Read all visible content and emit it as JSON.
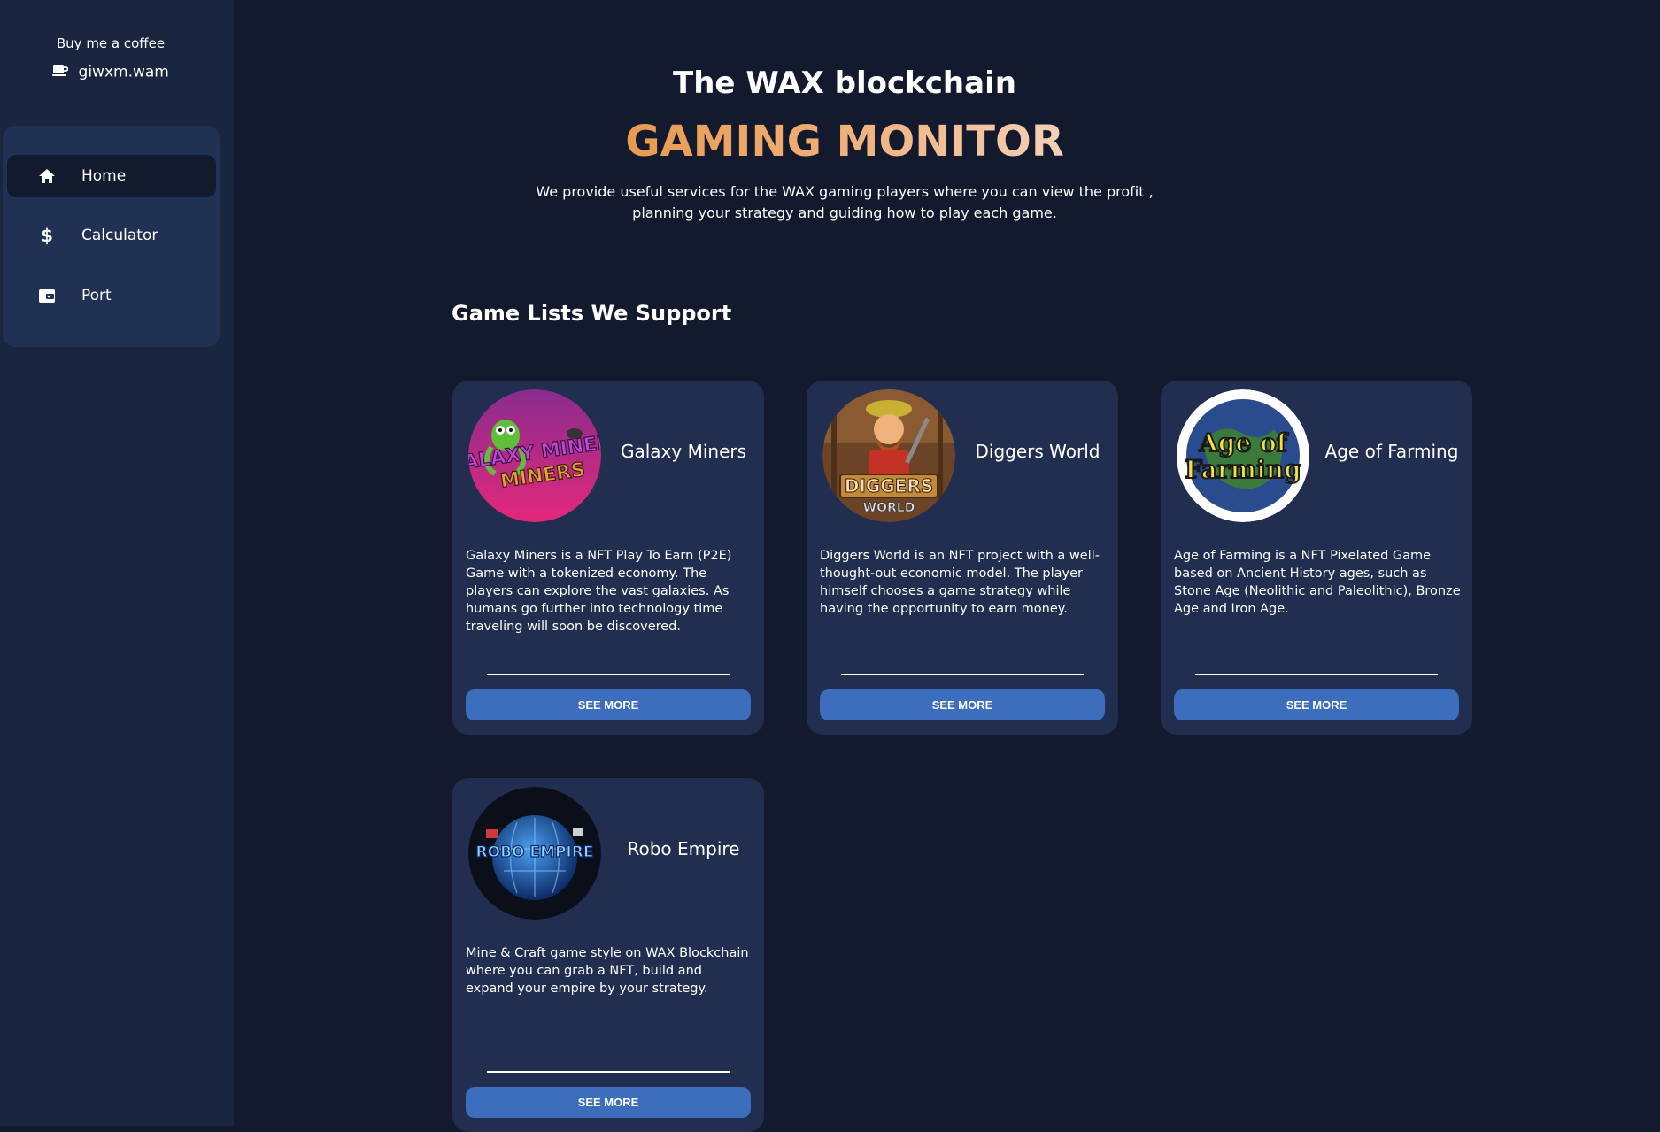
{
  "sidebar": {
    "coffee_label": "Buy me a coffee",
    "coffee_account": "giwxm.wam",
    "nav": [
      {
        "label": "Home",
        "icon": "home-icon",
        "active": true
      },
      {
        "label": "Calculator",
        "icon": "dollar-icon",
        "active": false
      },
      {
        "label": "Port",
        "icon": "wallet-icon",
        "active": false
      }
    ]
  },
  "hero": {
    "subtitle": "The WAX blockchain",
    "title": "GAMING MONITOR",
    "description_line1": "We provide useful services for the WAX gaming players where you can view the profit ,",
    "description_line2": "planning your strategy and guiding how to play each game."
  },
  "games_section": {
    "title": "Game Lists We Support",
    "button_label": "SEE MORE",
    "games": [
      {
        "name": "Galaxy Miners",
        "logo_text": "GALAXY MINERS",
        "description": "Galaxy Miners is a NFT Play To Earn (P2E) Game with a tokenized economy. The players can explore the vast galaxies. As humans go further into technology time traveling will soon be discovered."
      },
      {
        "name": "Diggers World",
        "logo_text": "DIGGERS WORLD",
        "description": "Diggers World is an NFT project with a well-thought-out economic model. The player himself chooses a game strategy while having the opportunity to earn money."
      },
      {
        "name": "Age of Farming",
        "logo_text": "Age of Farming",
        "description": "Age of Farming is a NFT Pixelated Game based on Ancient History ages, such as Stone Age (Neolithic and Paleolithic), Bronze Age and Iron Age."
      },
      {
        "name": "Robo Empire",
        "logo_text": "ROBO EMPIRE",
        "description": "Mine & Craft game style on WAX Blockchain where you can grab a NFT, build and expand your empire by your strategy."
      }
    ]
  },
  "colors": {
    "background": "#141a2e",
    "sidebar": "#1a2540",
    "card": "#212e4f",
    "button": "#3c6ebd",
    "accent": "#e89a4f"
  }
}
